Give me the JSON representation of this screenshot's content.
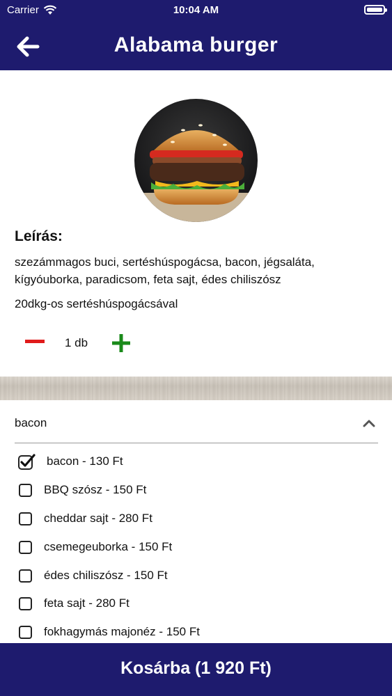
{
  "status_bar": {
    "carrier": "Carrier",
    "time": "10:04 AM"
  },
  "header": {
    "title": "Alabama burger"
  },
  "product": {
    "description_label": "Leírás:",
    "description": "szezámmagos buci, sertéshúspogácsa, bacon, jégsaláta, kígyóuborka, paradicsom, feta sajt, édes chiliszósz",
    "weight_note": "20dkg-os sertéshúspogácsával"
  },
  "quantity": {
    "value": "1 db"
  },
  "extras": {
    "section_title": "bacon",
    "options": [
      {
        "label": "bacon - 130 Ft",
        "checked": true
      },
      {
        "label": "BBQ szósz - 150 Ft",
        "checked": false
      },
      {
        "label": "cheddar sajt - 280 Ft",
        "checked": false
      },
      {
        "label": "csemegeuborka - 150 Ft",
        "checked": false
      },
      {
        "label": "édes chiliszósz - 150 Ft",
        "checked": false
      },
      {
        "label": "feta sajt - 280 Ft",
        "checked": false
      },
      {
        "label": "fokhagymás majonéz - 150 Ft",
        "checked": false
      }
    ]
  },
  "cart_button": {
    "label": "Kosárba (1 920 Ft)"
  },
  "colors": {
    "brand": "#1e1b6e",
    "minus": "#e01b1b",
    "plus": "#1a8a1a"
  }
}
